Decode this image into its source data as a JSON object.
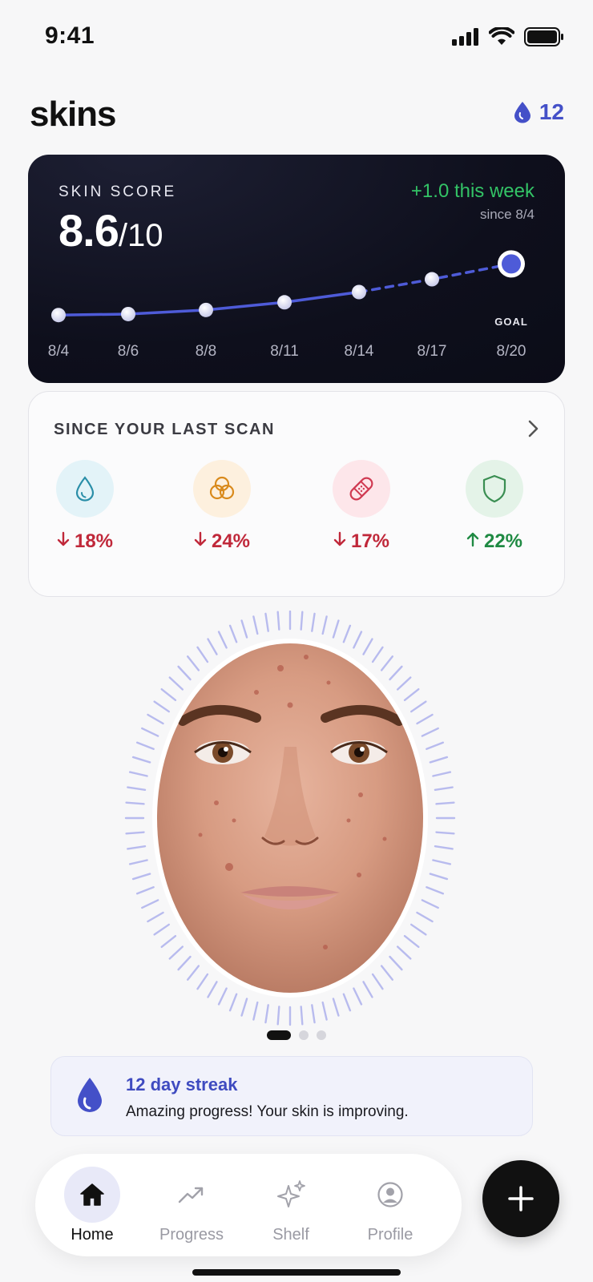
{
  "status_bar": {
    "time": "9:41"
  },
  "header": {
    "title": "skins",
    "streak_count": "12"
  },
  "score_card": {
    "label": "SKIN SCORE",
    "score": "8.6",
    "score_suffix": "/10",
    "week_delta": "+1.0 this week",
    "since": "since 8/4",
    "goal_label": "GOAL"
  },
  "chart_data": {
    "type": "line",
    "categories": [
      "8/4",
      "8/6",
      "8/8",
      "8/11",
      "8/14",
      "8/17",
      "8/20"
    ],
    "series": [
      {
        "values": [
          7.6,
          7.62,
          7.7,
          7.85,
          8.05,
          null,
          null
        ]
      },
      {
        "values": [
          null,
          null,
          null,
          null,
          8.05,
          8.3,
          8.6
        ]
      }
    ],
    "goal_index": 6,
    "colors": {
      "line": "#4e5bd8",
      "goal": "#4e5bd8"
    }
  },
  "scan_card": {
    "title": "SINCE YOUR LAST SCAN",
    "metrics": [
      {
        "icon": "water-drop-icon",
        "direction": "down",
        "delta": "18%",
        "bg": "#e3f3f8",
        "fg": "#2a8ea8",
        "color": "#c0283a"
      },
      {
        "icon": "pores-icon",
        "direction": "down",
        "delta": "24%",
        "bg": "#fdf0de",
        "fg": "#d98a1c",
        "color": "#c0283a"
      },
      {
        "icon": "bandage-icon",
        "direction": "down",
        "delta": "17%",
        "bg": "#fde6ea",
        "fg": "#d03a52",
        "color": "#c0283a"
      },
      {
        "icon": "shield-icon",
        "direction": "up",
        "delta": "22%",
        "bg": "#e4f3e8",
        "fg": "#3a8e52",
        "color": "#1f8a43"
      }
    ]
  },
  "carousel": {
    "pages": 3,
    "active": 0
  },
  "streak_banner": {
    "title": "12 day streak",
    "message": "Amazing progress! Your skin is improving."
  },
  "nav": {
    "items": [
      {
        "label": "Home",
        "icon": "home-icon",
        "active": true
      },
      {
        "label": "Progress",
        "icon": "trend-icon",
        "active": false
      },
      {
        "label": "Shelf",
        "icon": "sparkle-icon",
        "active": false
      },
      {
        "label": "Profile",
        "icon": "profile-icon",
        "active": false
      }
    ],
    "fab_icon": "plus-icon"
  }
}
